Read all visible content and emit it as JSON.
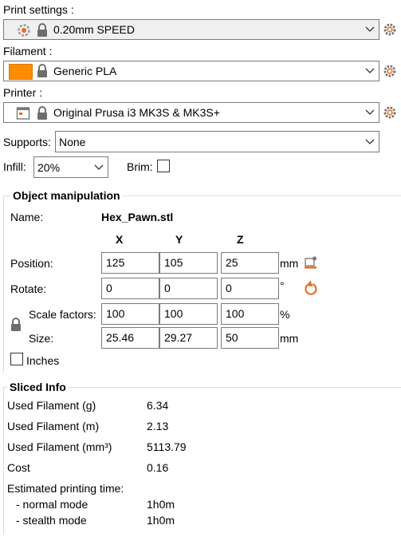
{
  "print_settings": {
    "label": "Print settings :",
    "value": "0.20mm SPEED"
  },
  "filament": {
    "label": "Filament :",
    "value": "Generic PLA",
    "color": "#ff8c00"
  },
  "printer": {
    "label": "Printer :",
    "value": "Original Prusa i3 MK3S & MK3S+"
  },
  "supports": {
    "label": "Supports:",
    "value": "None"
  },
  "infill": {
    "label": "Infill:",
    "value": "20%"
  },
  "brim": {
    "label": "Brim:",
    "checked": false
  },
  "object_manipulation": {
    "title": "Object manipulation",
    "name_label": "Name:",
    "name_value": "Hex_Pawn.stl",
    "axes": [
      "X",
      "Y",
      "Z"
    ],
    "position": {
      "label": "Position:",
      "x": "125",
      "y": "105",
      "z": "25",
      "unit": "mm"
    },
    "rotate": {
      "label": "Rotate:",
      "x": "0",
      "y": "0",
      "z": "0",
      "unit": "°"
    },
    "scale": {
      "label": "Scale factors:",
      "x": "100",
      "y": "100",
      "z": "100",
      "unit": "%"
    },
    "size": {
      "label": "Size:",
      "x": "25.46",
      "y": "29.27",
      "z": "50",
      "unit": "mm"
    },
    "inches_label": "Inches"
  },
  "sliced_info": {
    "title": "Sliced Info",
    "rows": [
      {
        "label": "Used Filament (g)",
        "value": "6.34"
      },
      {
        "label": "Used Filament (m)",
        "value": "2.13"
      },
      {
        "label": "Used Filament (mm³)",
        "value": "5113.79"
      },
      {
        "label": "Cost",
        "value": "0.16"
      }
    ],
    "time_label": "Estimated printing time:",
    "normal_label": "- normal mode",
    "normal_value": "1h0m",
    "stealth_label": "- stealth mode",
    "stealth_value": "1h0m"
  },
  "colors": {
    "accent": "#ed6b21",
    "icon_gray": "#6e6e6e"
  }
}
